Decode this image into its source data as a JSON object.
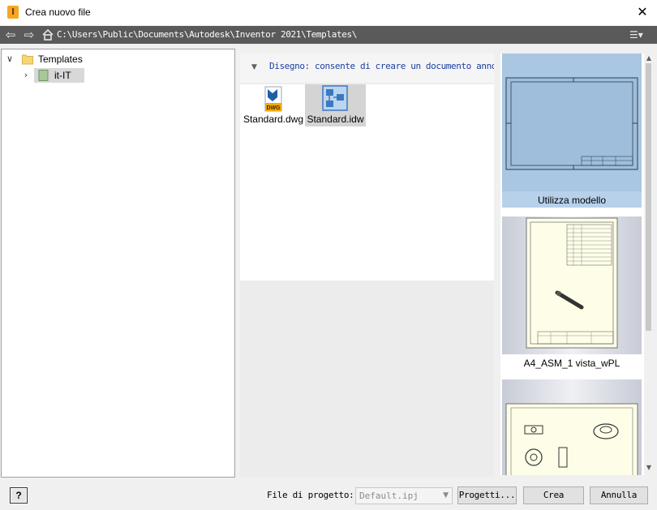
{
  "window": {
    "title": "Crea nuovo file",
    "close_label": "✕"
  },
  "pathbar": {
    "path": "C:\\Users\\Public\\Documents\\Autodesk\\Inventor 2021\\Templates\\"
  },
  "tree": {
    "root": {
      "label": "Templates"
    },
    "child": {
      "label": "it-IT"
    }
  },
  "group": {
    "header": "Disegno: consente di creare un documento annot"
  },
  "files": [
    {
      "name": "Standard.dwg",
      "badge": "DWG",
      "icon": "dwg-file-icon"
    },
    {
      "name": "Standard.idw",
      "icon": "idw-file-icon"
    }
  ],
  "previews": [
    {
      "label": "Utilizza modello"
    },
    {
      "label": "A4_ASM_1 vista_wPL"
    },
    {
      "label": ""
    }
  ],
  "footer": {
    "help_label": "?",
    "project_label": "File di progetto:",
    "project_value": "Default.ipj",
    "projects_button": "Progetti...",
    "create_button": "Crea",
    "cancel_button": "Annulla"
  },
  "colors": {
    "accent": "#1a3fa0",
    "selection": "#b7d1ea",
    "pathbar": "#5a5a5a"
  }
}
